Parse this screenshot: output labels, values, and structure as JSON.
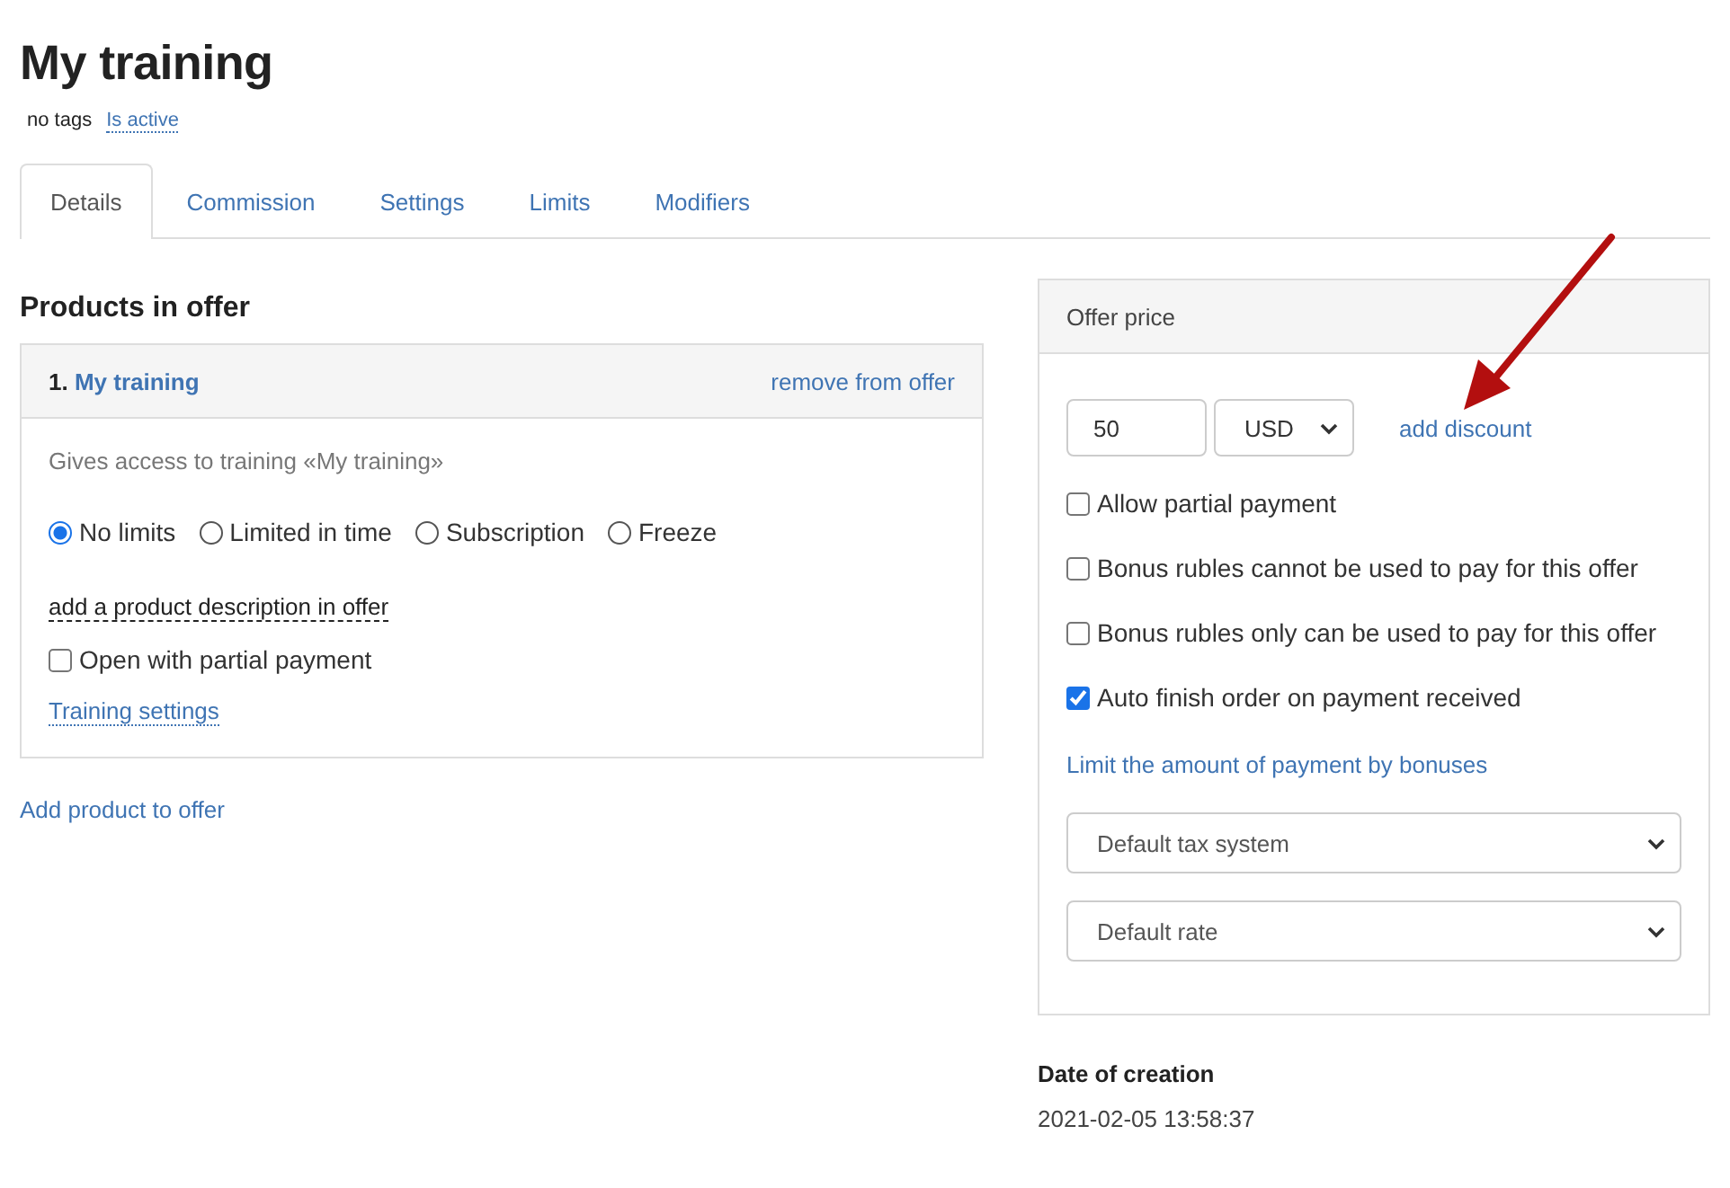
{
  "title": "My training",
  "meta": {
    "tags": "no tags",
    "status": "Is active"
  },
  "tabs": [
    {
      "label": "Details",
      "selected": true
    },
    {
      "label": "Commission",
      "selected": false
    },
    {
      "label": "Settings",
      "selected": false
    },
    {
      "label": "Limits",
      "selected": false
    },
    {
      "label": "Modifiers",
      "selected": false
    }
  ],
  "products": {
    "heading": "Products in offer",
    "items": [
      {
        "number": "1.",
        "name": "My training",
        "remove_link": "remove from offer",
        "access_text": "Gives access to training «My training»",
        "access_options": [
          {
            "label": "No limits",
            "selected": true
          },
          {
            "label": "Limited in time",
            "selected": false
          },
          {
            "label": "Subscription",
            "selected": false
          },
          {
            "label": "Freeze",
            "selected": false
          }
        ],
        "description_link": "add a product description in offer",
        "partial_payment": {
          "label": "Open with partial payment",
          "checked": false
        },
        "settings_link": "Training settings"
      }
    ],
    "add_link": "Add product to offer"
  },
  "price": {
    "heading": "Offer price",
    "amount": "50",
    "currency": "USD",
    "discount_link": "add discount",
    "options": [
      {
        "label": "Allow partial payment",
        "checked": false
      },
      {
        "label": "Bonus rubles cannot be used to pay for this offer",
        "checked": false
      },
      {
        "label": "Bonus rubles only can be used to pay for this offer",
        "checked": false
      },
      {
        "label": "Auto finish order on payment received",
        "checked": true
      }
    ],
    "bonus_limit_link": "Limit the amount of payment by bonuses",
    "tax_system": "Default tax system",
    "rate": "Default rate"
  },
  "created": {
    "label": "Date of creation",
    "value": "2021-02-05 13:58:37"
  }
}
